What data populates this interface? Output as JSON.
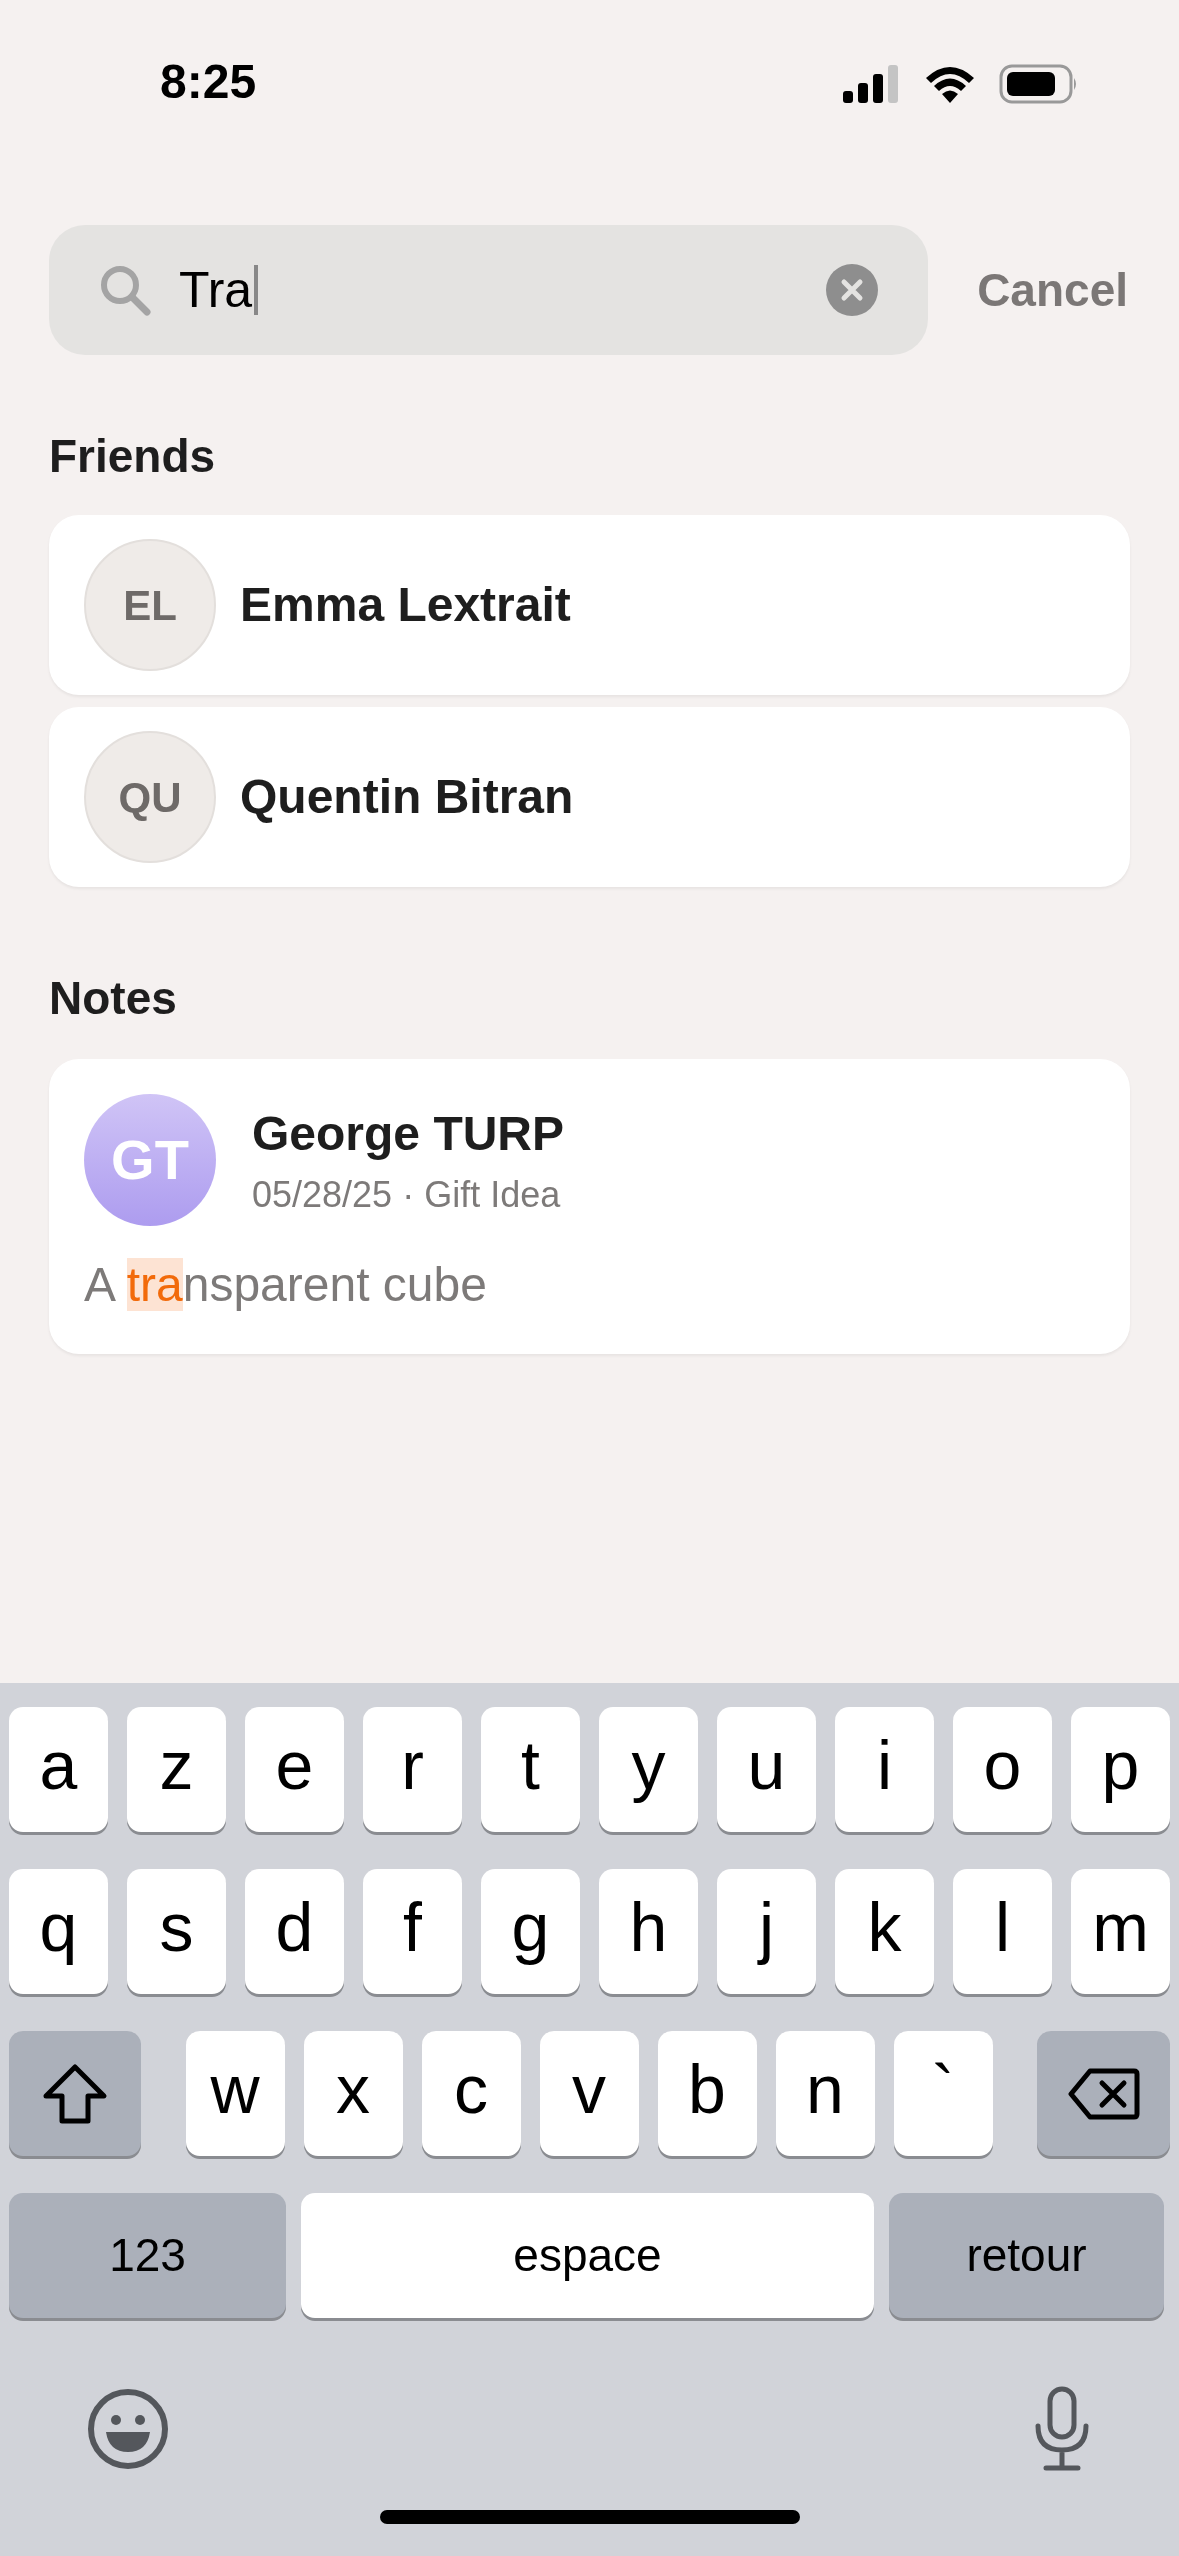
{
  "status_bar": {
    "time": "8:25"
  },
  "search": {
    "value": "Tra",
    "cancel": "Cancel"
  },
  "friends": {
    "title": "Friends",
    "items": [
      {
        "initials": "EL",
        "name": "Emma Lextrait"
      },
      {
        "initials": "QU",
        "name": "Quentin Bitran"
      }
    ]
  },
  "notes": {
    "title": "Notes",
    "items": [
      {
        "initials": "GT",
        "author": "George TURP",
        "meta": "05/28/25 · Gift Idea",
        "text_parts": [
          {
            "text": "A ",
            "highlighted": false
          },
          {
            "text": "tra",
            "highlighted": true
          },
          {
            "text": "nsparent cube",
            "highlighted": false
          }
        ]
      }
    ]
  },
  "keyboard": {
    "rows": [
      [
        {
          "kind": "letter",
          "label": "a"
        },
        {
          "kind": "letter",
          "label": "z"
        },
        {
          "kind": "letter",
          "label": "e"
        },
        {
          "kind": "letter",
          "label": "r"
        },
        {
          "kind": "letter",
          "label": "t"
        },
        {
          "kind": "letter",
          "label": "y"
        },
        {
          "kind": "letter",
          "label": "u"
        },
        {
          "kind": "letter",
          "label": "i"
        },
        {
          "kind": "letter",
          "label": "o"
        },
        {
          "kind": "letter",
          "label": "p"
        }
      ],
      [
        {
          "kind": "letter",
          "label": "q"
        },
        {
          "kind": "letter",
          "label": "s"
        },
        {
          "kind": "letter",
          "label": "d"
        },
        {
          "kind": "letter",
          "label": "f"
        },
        {
          "kind": "letter",
          "label": "g"
        },
        {
          "kind": "letter",
          "label": "h"
        },
        {
          "kind": "letter",
          "label": "j"
        },
        {
          "kind": "letter",
          "label": "k"
        },
        {
          "kind": "letter",
          "label": "l"
        },
        {
          "kind": "letter",
          "label": "m"
        }
      ],
      [
        {
          "kind": "shift"
        },
        {
          "kind": "letter",
          "label": "w"
        },
        {
          "kind": "letter",
          "label": "x"
        },
        {
          "kind": "letter",
          "label": "c"
        },
        {
          "kind": "letter",
          "label": "v"
        },
        {
          "kind": "letter",
          "label": "b"
        },
        {
          "kind": "letter",
          "label": "n"
        },
        {
          "kind": "letter",
          "label": "`"
        },
        {
          "kind": "delete"
        }
      ]
    ],
    "bottom_row": {
      "numbers": "123",
      "space": "espace",
      "return": "retour"
    }
  }
}
